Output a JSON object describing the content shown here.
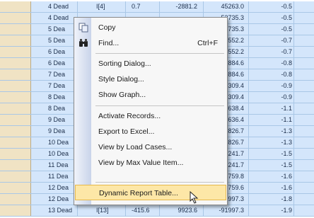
{
  "table": {
    "rows": [
      {
        "c1": "4 Dead",
        "c2": "I[4]",
        "c3": "0.7",
        "c4": "-2881.2",
        "c5": "45263.0",
        "c6": "-0.5"
      },
      {
        "c1": "4 Dead",
        "c2": "",
        "c3": "",
        "c4": "",
        "c5": "53735.3",
        "c6": "-0.5"
      },
      {
        "c1": "5 Dea",
        "c2": "",
        "c3": "",
        "c4": "",
        "c5": "53735.3",
        "c6": "-0.5"
      },
      {
        "c1": "5 Dea",
        "c2": "",
        "c3": "",
        "c4": "",
        "c5": "56552.2",
        "c6": "-0.7"
      },
      {
        "c1": "6 Dea",
        "c2": "",
        "c3": "",
        "c4": "",
        "c5": "56552.2",
        "c6": "-0.7"
      },
      {
        "c1": "6 Dea",
        "c2": "",
        "c3": "",
        "c4": "",
        "c5": "55884.6",
        "c6": "-0.8"
      },
      {
        "c1": "7 Dea",
        "c2": "",
        "c3": "",
        "c4": "",
        "c5": "55884.6",
        "c6": "-0.8"
      },
      {
        "c1": "7 Dea",
        "c2": "",
        "c3": "",
        "c4": "",
        "c5": "49309.4",
        "c6": "-0.9"
      },
      {
        "c1": "8 Dea",
        "c2": "",
        "c3": "",
        "c4": "",
        "c5": "49309.4",
        "c6": "-0.9"
      },
      {
        "c1": "8 Dea",
        "c2": "",
        "c3": "",
        "c4": "",
        "c5": "35638.4",
        "c6": "-1.1"
      },
      {
        "c1": "9 Dea",
        "c2": "",
        "c3": "",
        "c4": "",
        "c5": "35636.4",
        "c6": "-1.1"
      },
      {
        "c1": "9 Dea",
        "c2": "",
        "c3": "",
        "c4": "",
        "c5": "14826.7",
        "c6": "-1.3"
      },
      {
        "c1": "10 Dea",
        "c2": "",
        "c3": "",
        "c4": "",
        "c5": "14826.7",
        "c6": "-1.3"
      },
      {
        "c1": "10 Dea",
        "c2": "",
        "c3": "",
        "c4": "",
        "c5": "-13241.7",
        "c6": "-1.5"
      },
      {
        "c1": "11 Dea",
        "c2": "",
        "c3": "",
        "c4": "",
        "c5": "-13241.7",
        "c6": "-1.5"
      },
      {
        "c1": "11 Dea",
        "c2": "",
        "c3": "",
        "c4": "",
        "c5": "-48759.8",
        "c6": "-1.6"
      },
      {
        "c1": "12 Dea",
        "c2": "",
        "c3": "",
        "c4": "",
        "c5": "-48759.6",
        "c6": "-1.6"
      },
      {
        "c1": "12 Dea",
        "c2": "",
        "c3": "",
        "c4": "",
        "c5": "-91997.3",
        "c6": "-1.8"
      },
      {
        "c1": "13 Dead",
        "c2": "I[13]",
        "c3": "-415.6",
        "c4": "9923.6",
        "c5": "-91997.3",
        "c6": "-1.9"
      }
    ]
  },
  "menu": {
    "copy": "Copy",
    "find": "Find...",
    "find_shortcut": "Ctrl+F",
    "sorting": "Sorting Dialog...",
    "style": "Style Dialog...",
    "show_graph": "Show Graph...",
    "activate": "Activate Records...",
    "export": "Export to Excel...",
    "view_load": "View by Load Cases...",
    "view_max": "View by Max Value Item...",
    "dynamic": "Dynamic Report Table..."
  },
  "icons": {
    "copy": "copy-icon",
    "find": "binoculars-icon"
  },
  "colors": {
    "cell": "#d4e6fb",
    "header": "#f0e3c4",
    "highlight": "#fde7a7"
  }
}
